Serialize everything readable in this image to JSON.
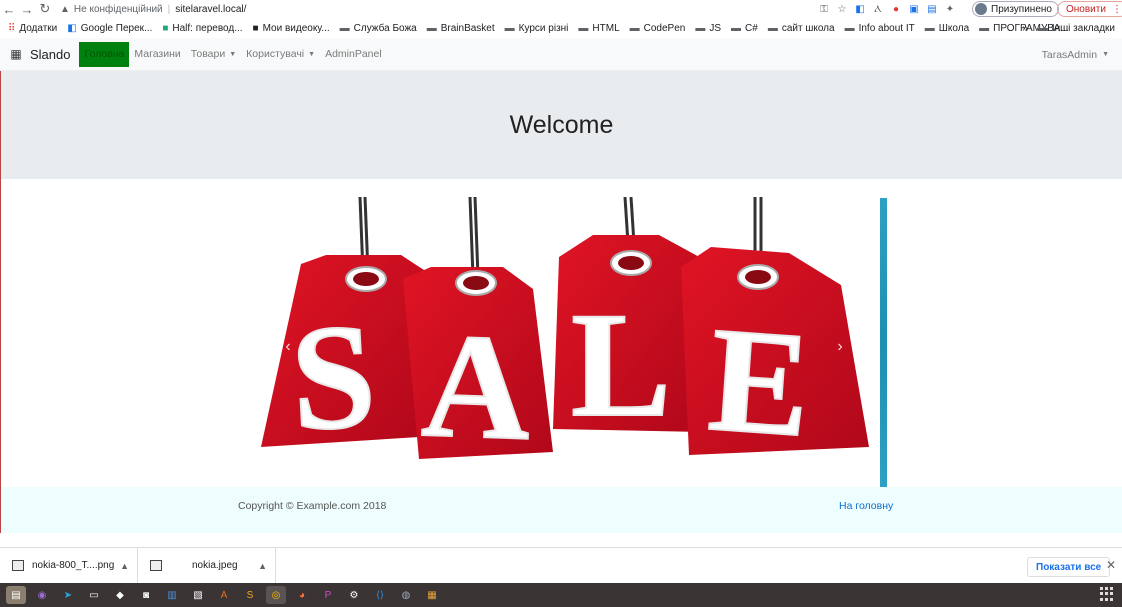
{
  "browser": {
    "security_label": "Не конфіденційний",
    "url": "sitelaravel.local/",
    "profile_status": "Призупинено",
    "update_label": "Оновити",
    "bookmarks": [
      {
        "label": "Додатки",
        "icon": "apps-grid-icon"
      },
      {
        "label": "Google Перек...",
        "icon": "translate-icon"
      },
      {
        "label": "Half: перевод...",
        "icon": "site-icon"
      },
      {
        "label": "Мои видеоку...",
        "icon": "site-icon"
      },
      {
        "label": "Служба Божа",
        "icon": "folder-icon"
      },
      {
        "label": "BrainBasket",
        "icon": "folder-icon"
      },
      {
        "label": "Курси різні",
        "icon": "folder-icon"
      },
      {
        "label": "HTML",
        "icon": "folder-icon"
      },
      {
        "label": "CodePen",
        "icon": "folder-icon"
      },
      {
        "label": "JS",
        "icon": "folder-icon"
      },
      {
        "label": "C#",
        "icon": "folder-icon"
      },
      {
        "label": "сайт школа",
        "icon": "folder-icon"
      },
      {
        "label": "Info about IT",
        "icon": "folder-icon"
      },
      {
        "label": "Школа",
        "icon": "folder-icon"
      },
      {
        "label": "ПРОГРАМУВА...",
        "icon": "folder-icon"
      }
    ],
    "bookmarks_overflow": "»",
    "other_bookmarks": "Інші закладки"
  },
  "site": {
    "brand": "Slando",
    "nav": {
      "home": "Головна",
      "shops": "Магазини",
      "products": "Товари",
      "users": "Користувачі",
      "admin": "AdminPanel",
      "user": "TarasAdmin"
    },
    "jumbotron_title": "Welcome",
    "carousel": {
      "slide_text": "SALE",
      "prev": "‹",
      "next": "›"
    },
    "footer": {
      "copyright": "Copyright © Example.com 2018",
      "home_link": "На головну"
    }
  },
  "downloads": {
    "items": [
      {
        "name": "nokia-800_T....png"
      },
      {
        "name": "nokia.jpeg"
      }
    ],
    "show_all": "Показати все",
    "close": "✕"
  },
  "colors": {
    "nav_active": "#00800f",
    "jumbotron_bg": "#e9ecef",
    "footer_bg": "#eefdfd",
    "link": "#0b6fd1",
    "tag_red": "#d0101f"
  }
}
